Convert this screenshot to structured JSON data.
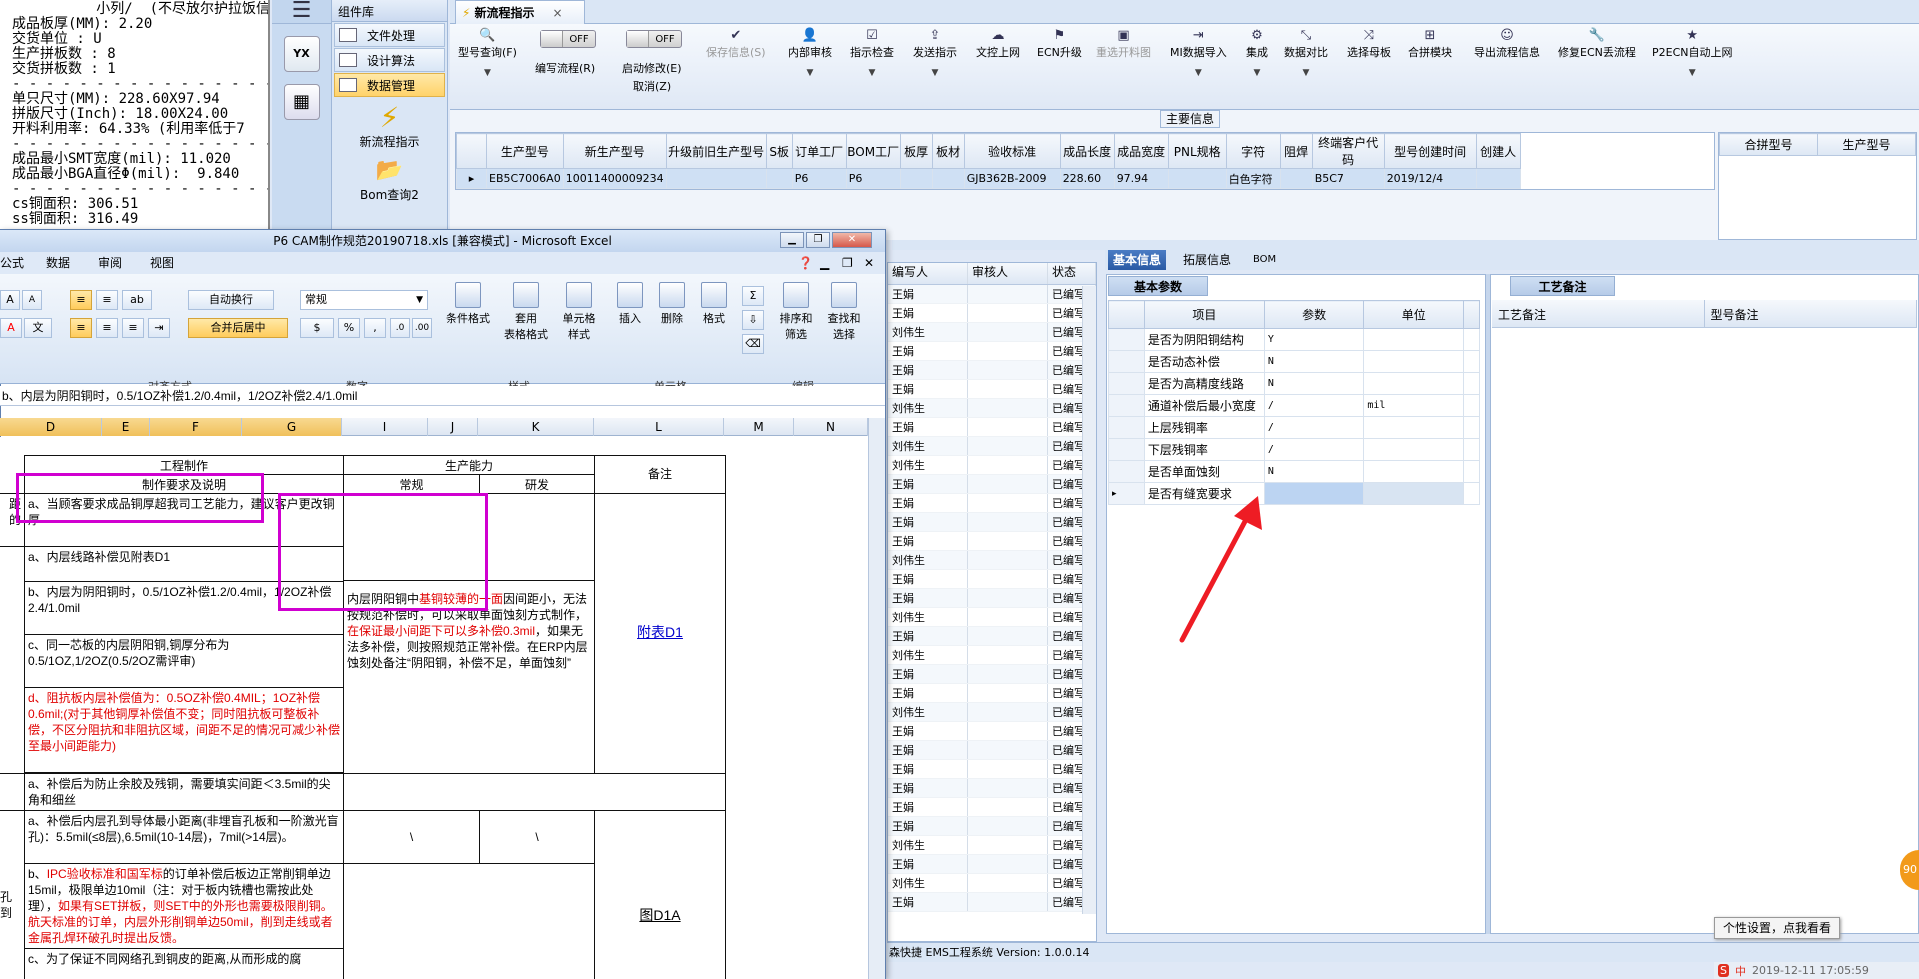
{
  "left_text_lines": [
    "          小列/  (不尽放尔护拉饭信忠",
    "成品板厚(MM): 2.20",
    "交货单位 : U",
    "生产拼板数 : 8",
    "交货拼板数 : 1",
    "- - - - - - - - - - - - - - - - - -",
    "单只尺寸(MM): 228.60X97.94",
    "拼版尺寸(Inch): 18.00X24.00",
    "开料利用率: 64.33% (利用率低于7",
    "- - - - - - - - - - - - - - - - - -",
    "成品最小SMT宽度(mil): 11.020",
    "成品最小BGA直径Φ(mil):  9.840",
    "- - - - - - - - - - - - - - - - - -",
    "cs铜面积: 306.51",
    "ss铜面积: 316.49"
  ],
  "component_library": {
    "title": "组件库",
    "items": [
      "文件处理",
      "设计算法",
      "数据管理"
    ],
    "big_items": [
      "新流程指示",
      "Bom查询2"
    ]
  },
  "main_tab": {
    "label": "新流程指示",
    "close": "×"
  },
  "toolbar": {
    "buttons": [
      {
        "label": "型号查询(F)",
        "icon": "search-icon",
        "disabled": false
      },
      {
        "label": "编写流程(R)",
        "icon": "toggle-off",
        "disabled": false
      },
      {
        "label": "启动修改(E)",
        "icon": "toggle-off",
        "disabled": false
      },
      {
        "label": "保存信息(S)",
        "icon": "check-icon",
        "disabled": true
      },
      {
        "label": "内部审核",
        "icon": "user-icon",
        "disabled": false
      },
      {
        "label": "指示检查",
        "icon": "checklist-icon",
        "disabled": false
      },
      {
        "label": "发送指示",
        "icon": "upload-icon",
        "disabled": false
      },
      {
        "label": "文控上网",
        "icon": "cloud-icon",
        "disabled": false
      },
      {
        "label": "ECN升级",
        "icon": "ecn-icon",
        "disabled": false
      },
      {
        "label": "重选开料图",
        "icon": "image-icon",
        "disabled": true
      },
      {
        "label": "MI数据导入",
        "icon": "import-icon",
        "disabled": false
      },
      {
        "label": "集成",
        "icon": "integrate-icon",
        "disabled": false
      },
      {
        "label": "数据对比",
        "icon": "compare-icon",
        "disabled": false
      },
      {
        "label": "选择母板",
        "icon": "shuffle-icon",
        "disabled": false
      },
      {
        "label": "合拼模块",
        "icon": "merge-icon",
        "disabled": false
      },
      {
        "label": "导出流程信息",
        "icon": "smile-icon",
        "disabled": false
      },
      {
        "label": "修复ECN丢流程",
        "icon": "wrench-icon",
        "disabled": false
      },
      {
        "label": "P2ECN自动上网",
        "icon": "star-icon",
        "disabled": false
      }
    ],
    "toggle_off_text": "OFF",
    "cancel_label": "取消(Z)"
  },
  "main_info": {
    "title": "主要信息",
    "columns": [
      "生产型号",
      "新生产型号",
      "升级前旧生产型号",
      "S板",
      "订单工厂",
      "BOM工厂",
      "板厚",
      "板材",
      "验收标准",
      "成品长度",
      "成品宽度",
      "PNL规格",
      "字符",
      "阻焊",
      "终端客户代码",
      "型号创建时间",
      "创建人"
    ],
    "row": [
      "EB5C7006A0",
      "10011400009234",
      "",
      "",
      "P6",
      "P6",
      "",
      "",
      "GJB362B-2009",
      "228.60",
      "97.94",
      "",
      "白色字符",
      "",
      "B5C7",
      "2019/12/4",
      ""
    ]
  },
  "merge_grid": {
    "columns": [
      "合拼型号",
      "生产型号"
    ]
  },
  "mid_list": {
    "columns": [
      "编写人",
      "审核人",
      "状态"
    ],
    "writers": [
      "王娟",
      "王娟",
      "刘伟生",
      "王娟",
      "王娟",
      "王娟",
      "刘伟生",
      "王娟",
      "刘伟生",
      "刘伟生",
      "王娟",
      "王娟",
      "王娟",
      "王娟",
      "刘伟生",
      "王娟",
      "王娟",
      "刘伟生",
      "王娟",
      "刘伟生",
      "王娟",
      "王娟",
      "刘伟生",
      "王娟",
      "王娟",
      "王娟",
      "王娟",
      "王娟",
      "王娟",
      "刘伟生",
      "王娟",
      "刘伟生",
      "王娟"
    ],
    "status": "已编写"
  },
  "info_tabs": [
    "基本信息",
    "拓展信息",
    "BOM"
  ],
  "basic_params": {
    "title": "基本参数",
    "columns": [
      "项目",
      "参数",
      "单位"
    ],
    "rows": [
      [
        "是否为阴阳铜结构",
        "Y",
        ""
      ],
      [
        "是否动态补偿",
        "N",
        ""
      ],
      [
        "是否为高精度线路",
        "N",
        ""
      ],
      [
        "通道补偿后最小宽度",
        "/",
        "mil"
      ],
      [
        "上层残铜率",
        "/",
        ""
      ],
      [
        "下层残铜率",
        "/",
        ""
      ],
      [
        "是否单面蚀刻",
        "N",
        ""
      ],
      [
        "是否有缝宽要求",
        "",
        ""
      ]
    ]
  },
  "craft_panel": {
    "title": "工艺备注",
    "columns": [
      "工艺备注",
      "型号备注"
    ]
  },
  "status_bar": "森快捷  EMS工程系统  Version: 1.0.0.14",
  "tooltip": "个性设置，点我看看",
  "orange_badge": "90",
  "taskbar": {
    "ime": "中",
    "time": "2019-12-11 17:05:59"
  },
  "excel": {
    "title": "P6 CAM制作规范20190718.xls  [兼容模式] - Microsoft Excel",
    "menu": [
      "公式",
      "数据",
      "审阅",
      "视图"
    ],
    "font_sizes": [
      "A",
      "A"
    ],
    "wrap_label": "自动换行",
    "merge_label": "合并后居中",
    "number_format": "常规",
    "groups": [
      "对齐方式",
      "数字",
      "样式",
      "单元格",
      "编辑"
    ],
    "buttons": [
      "条件格式",
      "套用\n表格格式",
      "单元格\n样式",
      "插入",
      "删除",
      "格式",
      "排序和\n筛选",
      "查找和\n选择"
    ],
    "formula": "b、内层为阴阳铜时，0.5/1OZ补偿1.2/0.4mil，1/2OZ补偿2.4/1.0mil",
    "col_headers": [
      "D",
      "E",
      "F",
      "G",
      "I",
      "J",
      "K",
      "L",
      "M",
      "N"
    ],
    "header_engineering": "工程制作",
    "header_req": "制作要求及说明",
    "header_capacity": "生产能力",
    "header_normal": "常规",
    "header_rd": "研发",
    "header_note": "备注",
    "left_frag_1": "距的",
    "left_frag_2": "孔到",
    "cells": {
      "a1": "a、当顾客要求成品铜厚超我司工艺能力，建议客户更改铜厚",
      "a2": "a、内层线路补偿见附表D1",
      "b2": "b、内层为阴阳铜时，0.5/1OZ补偿1.2/0.4mil，1/2OZ补偿2.4/1.0mil",
      "c2": "c、同一芯板的内层阴阳铜,铜厚分布为0.5/1OZ,1/2OZ(0.5/2OZ需评审)",
      "d2a": "d、阻抗板内层补偿值为：0.5OZ补偿0.4MIL；1OZ补偿0.6mil;(对于其他铜厚补偿值不变；同时阻抗板可整板补偿，不区分阻抗和非阻抗区域，间距不足的情况可减少补偿至最小间距能力)",
      "note_pre": "内层阴阳铜中",
      "note_red1": "基铜较薄的一面",
      "note_mid": "因间距小，无法按规范补偿时，可以采取单面蚀刻方式制作，",
      "note_red2": "在保证最小间距下可以多补偿0.3mil",
      "note_post": "，如果无法多补偿，则按照规范正常补偿。在ERP内层蚀刻处备注“阴阳铜，补偿不足，单面蚀刻”",
      "link_d1": "附表D1",
      "a3": "a、补偿后为防止余胶及残铜，需要填实间距＜3.5mil的尖角和细丝",
      "a4": "a、补偿后内层孔到导体最小距离(非埋盲孔板和一阶激光盲孔)：5.5mil(≤8层),6.5mil(10-14层)，7mil(>14层)。",
      "slash": "\\",
      "b4_pre": "b、",
      "b4_red1": "IPC验收标准和国军标",
      "b4_mid": "的订单补偿后板边正常削铜单边15mil，极限单边10mil（注：对于板内铣槽也需按此处理），",
      "b4_red2": "如果有SET拼板，则SET中的外形也需要极限削铜。航天标准的订单，内层外形削铜单边50mil，削到走线或者金属孔焊环破孔时提出反馈。",
      "link_d1a": "图D1A",
      "c4": "c、为了保证不同网络孔到铜皮的距离,从而形成的腐"
    }
  }
}
